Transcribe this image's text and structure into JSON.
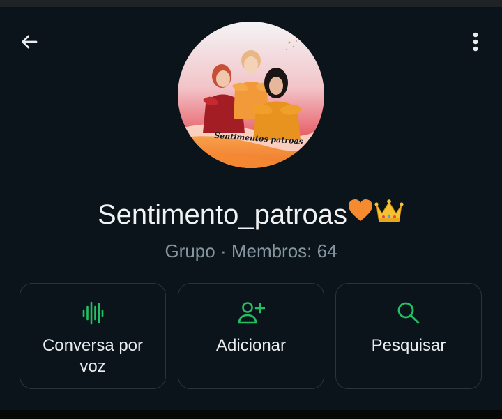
{
  "header": {
    "back_icon": "arrow-left-icon",
    "menu_icon": "more-vertical-icon"
  },
  "profile": {
    "avatar_text": "Sentimentos patroas",
    "name": "Sentimento_patroas",
    "name_emojis": [
      "orange-heart-icon",
      "crown-icon"
    ],
    "subtitle": "Grupo · Membros: 64"
  },
  "actions": [
    {
      "icon": "voice-waveform-icon",
      "label": "Conversa por voz"
    },
    {
      "icon": "add-person-icon",
      "label": "Adicionar"
    },
    {
      "icon": "search-icon",
      "label": "Pesquisar"
    }
  ],
  "colors": {
    "background": "#0b141a",
    "accent": "#21c063",
    "text": "#e9edef",
    "secondary_text": "#8696a0",
    "card_border": "#2d3439"
  }
}
